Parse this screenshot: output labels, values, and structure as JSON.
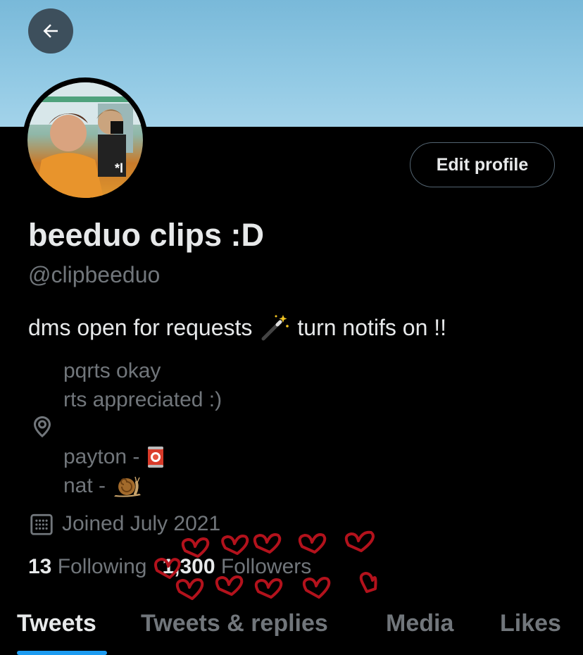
{
  "banner": {
    "color": "#91c9e4"
  },
  "back_button": {
    "icon": "arrow-left-icon"
  },
  "avatar": {
    "overlay_text": "*l"
  },
  "edit_profile_label": "Edit profile",
  "profile": {
    "display_name": "beeduo clips :D",
    "handle": "@clipbeeduo",
    "bio_start": "dms open for requests",
    "bio_end": "turn notifs on !!",
    "bio_emoji": "magic-wand-icon"
  },
  "location": {
    "icon": "location-pin-icon",
    "lines": [
      "pqrts okay",
      "rts appreciated :)"
    ],
    "payton": "payton -",
    "nat": "nat -"
  },
  "joined": {
    "icon": "calendar-icon",
    "text": "Joined July 2021"
  },
  "stats": {
    "following_count": "13",
    "following_label": "Following",
    "followers_count": "1,300",
    "followers_label": "Followers"
  },
  "tabs": [
    {
      "label": "Tweets",
      "active": true
    },
    {
      "label": "Tweets & replies",
      "active": false
    },
    {
      "label": "Media",
      "active": false
    },
    {
      "label": "Likes",
      "active": false
    }
  ],
  "colors": {
    "accent": "#1d9bf0",
    "muted": "#71767b",
    "text": "#e7e9ea",
    "hearts": "#b3121c"
  }
}
